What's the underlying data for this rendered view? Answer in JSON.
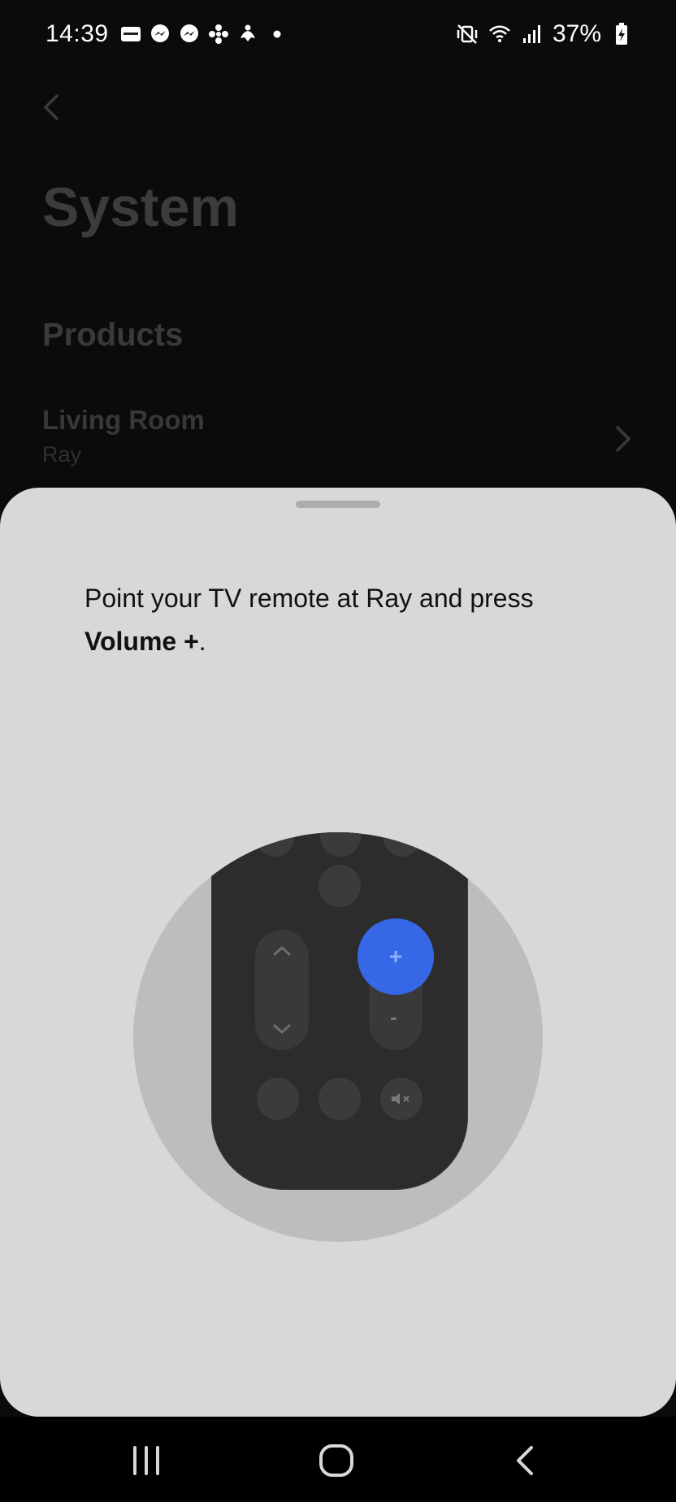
{
  "status_bar": {
    "time": "14:39",
    "battery": "37%",
    "notification_icons": [
      "sonos-icon",
      "messenger-icon",
      "messenger-icon",
      "fan-icon",
      "meditation-icon",
      "dot-icon"
    ],
    "status_icons": [
      "mute-vibrate-icon",
      "wifi-icon",
      "signal-icon",
      "battery-charging-icon"
    ]
  },
  "background_page": {
    "title": "System",
    "section": "Products",
    "product": {
      "room": "Living Room",
      "model": "Ray"
    }
  },
  "sheet": {
    "instruction_text": "Point your TV remote at Ray and press",
    "instruction_key": "Volume +",
    "instruction_end": ".",
    "accent_color": "#3667e6"
  },
  "remote": {
    "volume_up_symbol": "+",
    "volume_down_symbol": "-"
  }
}
